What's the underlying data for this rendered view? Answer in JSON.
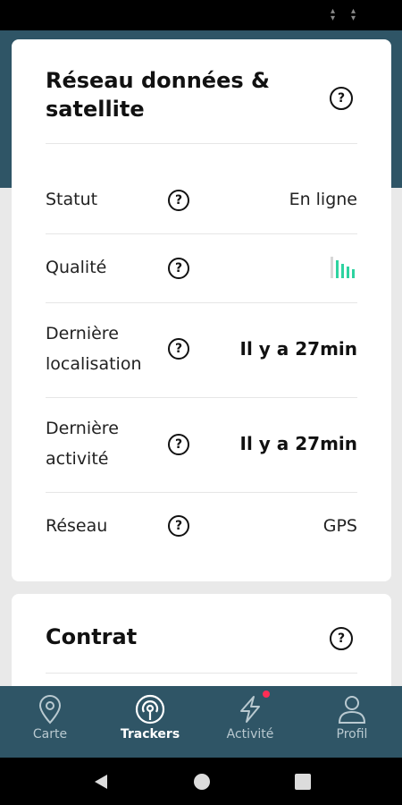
{
  "network_card": {
    "title": "Réseau données & satellite",
    "help_icon": "question-circle-icon",
    "rows": [
      {
        "label": "Statut",
        "value": "En ligne"
      },
      {
        "label": "Qualité",
        "value_icon": "signal-strength-icon",
        "signal_bars_active": 4,
        "signal_bars_total": 5,
        "signal_color": "#2ed3a0"
      },
      {
        "label": "Dernière localisation",
        "value": "Il y a 27min"
      },
      {
        "label": "Dernière activité",
        "value": "Il y a 27min"
      },
      {
        "label": "Réseau",
        "value": "GPS"
      }
    ]
  },
  "contract_card": {
    "title": "Contrat",
    "help_icon": "question-circle-icon"
  },
  "bottom_nav": {
    "items": [
      {
        "label": "Carte",
        "icon": "map-pin-icon",
        "active": false
      },
      {
        "label": "Trackers",
        "icon": "tracker-icon",
        "active": true
      },
      {
        "label": "Activité",
        "icon": "lightning-icon",
        "active": false,
        "badge": true
      },
      {
        "label": "Profil",
        "icon": "user-icon",
        "active": false
      }
    ]
  },
  "colors": {
    "header_bg": "#2f5566",
    "nav_bg": "#2f5566",
    "accent_signal": "#2ed3a0",
    "badge": "#ff2d55",
    "page_bg": "#e9e9e9"
  }
}
